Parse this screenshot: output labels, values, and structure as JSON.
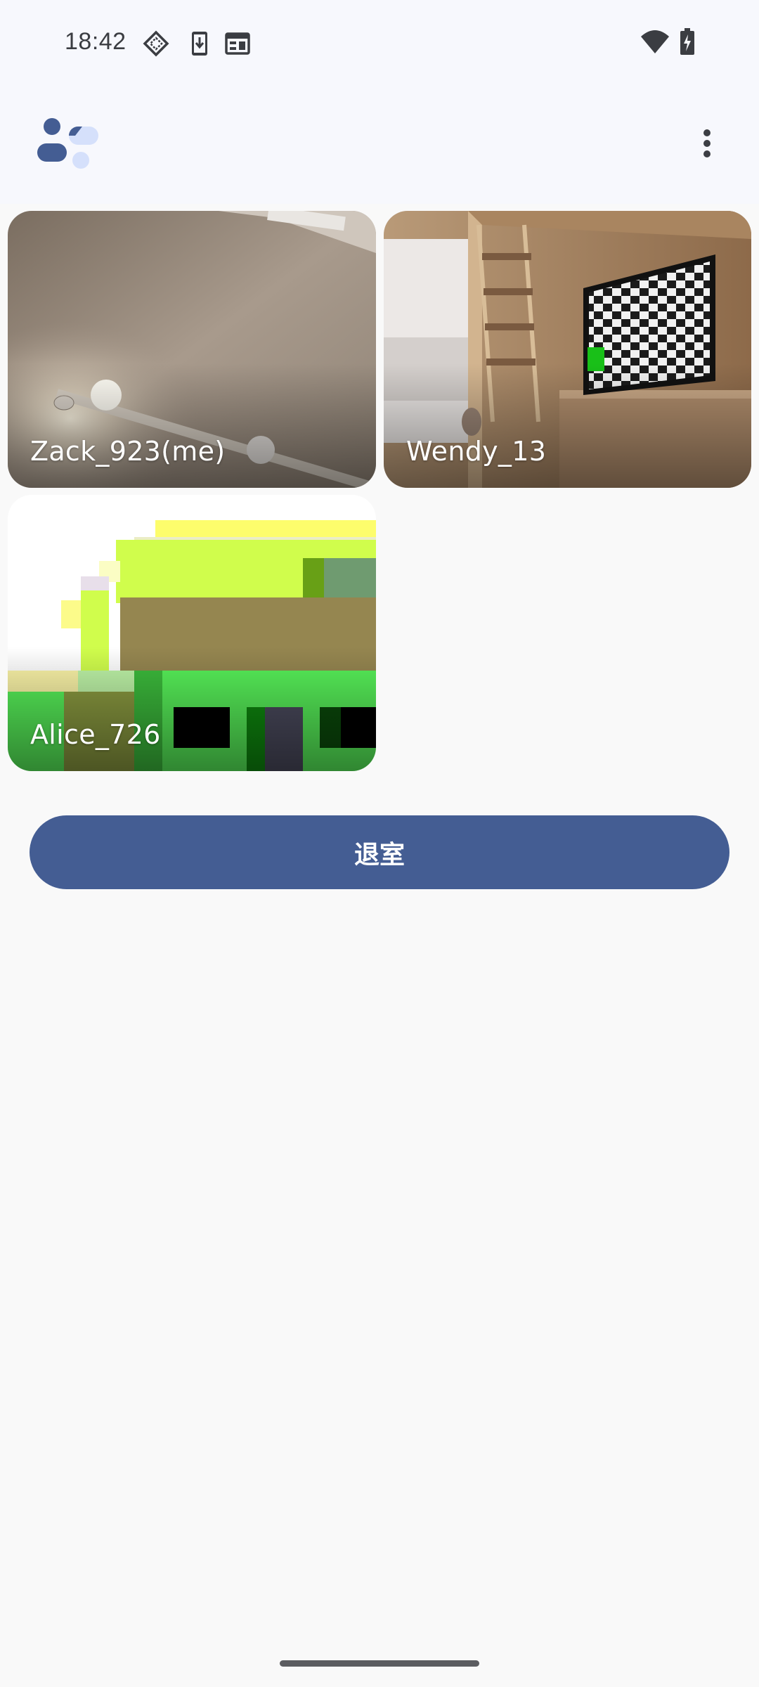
{
  "status_bar": {
    "time": "18:42",
    "left_icons": [
      "cast-diamond-icon",
      "download-phone-icon",
      "calendar-window-icon"
    ],
    "right_icons": [
      "wifi-icon",
      "battery-charging-icon"
    ]
  },
  "app_bar": {
    "logo": "app-logo-icon",
    "menu": "more-vert-icon"
  },
  "participants": [
    {
      "name": "Zack_923(me)"
    },
    {
      "name": "Wendy_13"
    },
    {
      "name": "Alice_726"
    }
  ],
  "actions": {
    "leave_label": "退室"
  },
  "colors": {
    "primary": "#445d93",
    "logo_dark": "#445d93",
    "logo_light": "#d5e0fb",
    "background": "#f9f9f9"
  }
}
